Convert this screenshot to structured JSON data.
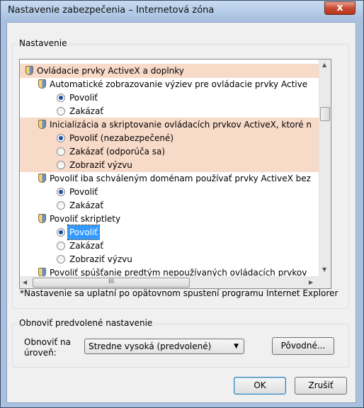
{
  "window": {
    "title": "Nastavenie zabezpečenia – Internetová zóna",
    "close_label": "x"
  },
  "settings_group": {
    "legend": "Nastavenie",
    "items": [
      {
        "kind": "category",
        "text": "Ovládacie prvky ActiveX a doplnky",
        "highlight": true
      },
      {
        "kind": "setting",
        "text": "Automatické zobrazovanie výziev pre ovládacie prvky Active"
      },
      {
        "kind": "option",
        "text": "Povoliť",
        "checked": true
      },
      {
        "kind": "option",
        "text": "Zakázať",
        "checked": false
      },
      {
        "kind": "setting",
        "text": "Inicializácia a skriptovanie ovládacích prvkov ActiveX, ktoré n",
        "highlight": true
      },
      {
        "kind": "option",
        "text": "Povoliť (nezabezpečené)",
        "checked": true,
        "highlight": true
      },
      {
        "kind": "option",
        "text": "Zakázať (odporúča sa)",
        "checked": false,
        "highlight": true
      },
      {
        "kind": "option",
        "text": "Zobraziť výzvu",
        "checked": false,
        "highlight": true
      },
      {
        "kind": "setting",
        "text": "Povoliť iba schváleným doménam používať prvky ActiveX bez"
      },
      {
        "kind": "option",
        "text": "Povoliť",
        "checked": true
      },
      {
        "kind": "option",
        "text": "Zakázať",
        "checked": false
      },
      {
        "kind": "setting",
        "text": "Povoliť skriptlety"
      },
      {
        "kind": "option",
        "text": "Povoliť",
        "checked": true,
        "selected": true
      },
      {
        "kind": "option",
        "text": "Zakázať",
        "checked": false
      },
      {
        "kind": "option",
        "text": "Zobraziť výzvu",
        "checked": false
      },
      {
        "kind": "setting",
        "text": "Povoliť spúšťanie predtým nepoužívaných ovládacích prvkov"
      }
    ],
    "hscroll_grip": "III",
    "note": "*Nastavenie sa uplatní po opätovnom spustení programu Internet Explorer"
  },
  "reset_group": {
    "legend": "Obnoviť predvolené nastavenie",
    "level_label_line1": "Obnoviť na",
    "level_label_line2": "úroveň:",
    "level_value": "Stredne vysoká (predvolené)",
    "reset_button": "Pôvodné..."
  },
  "buttons": {
    "ok": "OK",
    "cancel": "Zrušiť"
  }
}
